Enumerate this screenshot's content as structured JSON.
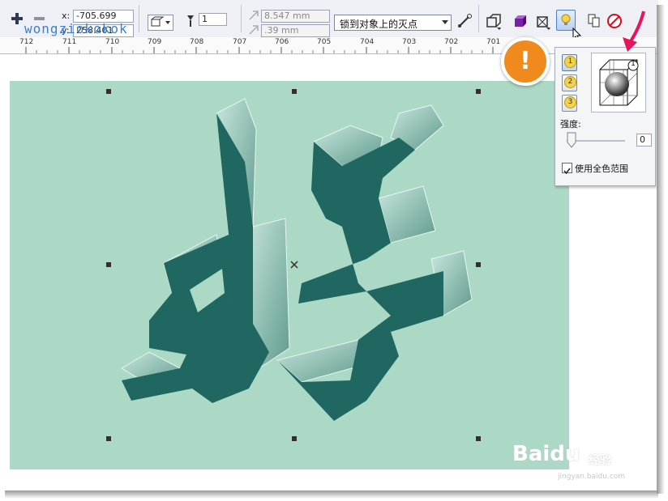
{
  "toolbar": {
    "x_label": "x:",
    "x_value": "-705.699 mm",
    "y_label": "y:",
    "y_value": "258.401 mm",
    "width_value": "8.547 mm",
    "depth_value": ".39 mm",
    "rotation_value": "1",
    "lock_select": "锁到对象上的灭点",
    "brand_watermark": "wongziokokok"
  },
  "ruler": {
    "ticks": [
      "712",
      "711",
      "710",
      "709",
      "708",
      "707",
      "706",
      "705",
      "704",
      "703",
      "702",
      "701"
    ]
  },
  "canvas": {
    "background_color": "#acd9c6",
    "artwork_text": "好",
    "artwork_color": "#1f6760",
    "bevel_color": "#7ab9ac"
  },
  "lighting_panel": {
    "light_buttons": [
      "1",
      "2",
      "3"
    ],
    "preview_badge": "1",
    "intensity_label": "强度:",
    "intensity_value": "0",
    "full_color_label": "使用全色范围",
    "full_color_checked": true
  },
  "annotation": {
    "badge_text": "!",
    "badge_color": "#f08a1c",
    "arrow_color": "#e8145b"
  },
  "watermark": {
    "logo": "Baidu",
    "suffix": "经验",
    "url": "jingyan.baidu.com"
  }
}
